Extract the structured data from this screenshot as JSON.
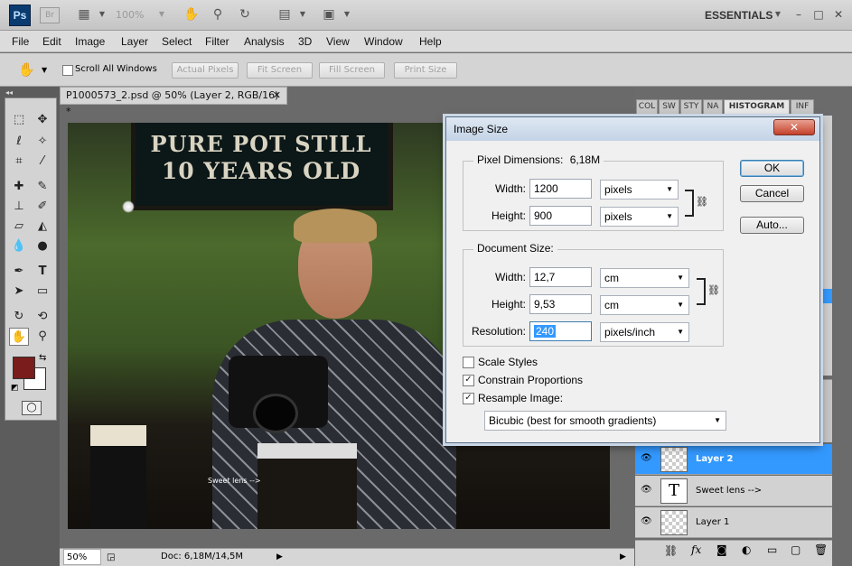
{
  "appbar": {
    "logo": "Ps",
    "bridge": "Br",
    "zoom": "100%",
    "workspace": "ESSENTIALS",
    "icons": [
      "view-extras-icon",
      "hand-icon",
      "zoom-icon",
      "rotate-view-icon",
      "arrange-documents-icon",
      "screen-mode-icon"
    ],
    "window_buttons": [
      "–",
      "□",
      "✕"
    ]
  },
  "menu": [
    "File",
    "Edit",
    "Image",
    "Layer",
    "Select",
    "Filter",
    "Analysis",
    "3D",
    "View",
    "Window",
    "Help"
  ],
  "options": {
    "scroll_all": "Scroll All Windows",
    "buttons": [
      "Actual Pixels",
      "Fit Screen",
      "Fill Screen",
      "Print Size"
    ]
  },
  "document": {
    "tab_title": "P1000573_2.psd @ 50% (Layer 2, RGB/16) *",
    "photo_sign": [
      "PURE POT STILL",
      "10 YEARS OLD"
    ],
    "photo_text": "Sweet lens -->",
    "status_zoom": "50%",
    "status_doc": "Doc: 6,18M/14,5M"
  },
  "panels": {
    "tabs": [
      "COL",
      "SW",
      "STY",
      "NA",
      "HISTOGRAM",
      "INF"
    ],
    "layers": [
      {
        "name": "Layer 2",
        "kind": "raster",
        "selected": true
      },
      {
        "name": "Sweet lens -->",
        "kind": "text",
        "selected": false
      },
      {
        "name": "Layer 1",
        "kind": "raster",
        "selected": false
      }
    ]
  },
  "colors": {
    "foreground": "#7a1c1c",
    "background": "#ffffff",
    "accent": "#3399ff"
  },
  "dialog": {
    "title": "Image Size",
    "pixel_dimensions_label": "Pixel Dimensions:",
    "pixel_dimensions_value": "6,18M",
    "width_label": "Width:",
    "height_label": "Height:",
    "resolution_label": "Resolution:",
    "px_width": "1200",
    "px_height": "900",
    "px_unit": "pixels",
    "document_size_label": "Document Size:",
    "doc_width": "12,7",
    "doc_height": "9,53",
    "doc_unit": "cm",
    "resolution": "240",
    "resolution_unit": "pixels/inch",
    "scale_styles": "Scale Styles",
    "constrain": "Constrain Proportions",
    "resample": "Resample Image:",
    "resample_method": "Bicubic (best for smooth gradients)",
    "ok": "OK",
    "cancel": "Cancel",
    "auto": "Auto...",
    "close": "✕"
  }
}
